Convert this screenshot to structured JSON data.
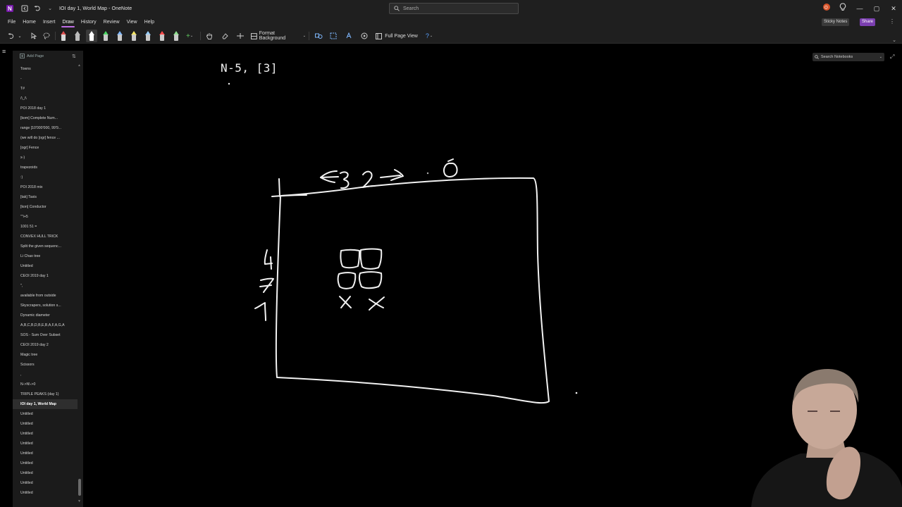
{
  "window": {
    "title": "IOI day 1, World Map - OneNote",
    "search_placeholder": "Search"
  },
  "menu": {
    "items": [
      "File",
      "Home",
      "Insert",
      "Draw",
      "History",
      "Review",
      "View",
      "Help"
    ],
    "active": "Draw",
    "sticky_notes": "Sticky Notes",
    "share": "Share"
  },
  "ribbon": {
    "format_background": "Format Background",
    "full_page_view": "Full Page View",
    "pen_colors": [
      "#d8d8d8",
      "#ffffff",
      "#4cd964",
      "#7fb8ff",
      "#f5e663",
      "#9ad0ff",
      "#4a90ff",
      "#ff4b4b",
      "#8fe08f"
    ]
  },
  "sidebar": {
    "add_page": "Add Page",
    "pages": [
      "Towns",
      "-",
      "T#",
      "/\\_/\\",
      "POI 2018 day 1",
      "[kom] Complete Num...",
      "range [10'000'000, 99'9...",
      "(we will do [ogr] fence ...",
      "[ogr] Fence",
      "x-)",
      "trapezoids",
      ":)",
      "POI 2018 mix",
      "[tak] Taxis",
      "[kon] Conductor",
      "\"\"i+5",
      "1001 51 =",
      "CONVEX HULL TRICK",
      "Split the given sequenc...",
      "Li Chao tree",
      "Untitled",
      "CEOI 2019 day 1",
      "\",",
      "available from outside",
      "Skyscrapers, solution s...",
      "Dynamic diameter",
      "A,B,C,B,D,B,E,B,A,F,A,G,A",
      "SOS - Sum Over Subset",
      "CEOI 2019 day 2",
      "Magic tree",
      "Scissors",
      ",",
      "N->N\\->0",
      "TRIPLE PEAKS (day 1)",
      "IOI day 1, World Map",
      "Untitled",
      "Untitled",
      "Untitled",
      "Untitled",
      "Untitled",
      "Untitled",
      "Untitled",
      "Untitled",
      "Untitled"
    ],
    "selected_index": 34
  },
  "page": {
    "heading": "N-5, [3]",
    "search_notebooks": "Search Notebooks"
  },
  "colors": {
    "accent": "#c06ee8",
    "share": "#7b3fb0",
    "ink": "#f2f2f2"
  }
}
